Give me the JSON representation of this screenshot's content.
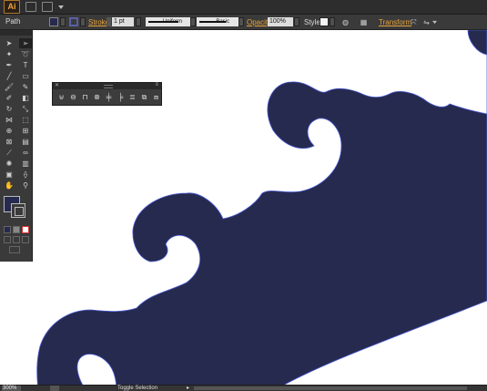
{
  "app": {
    "logo": "Ai"
  },
  "menubar": {
    "icons": [
      "document-icon",
      "workspace-icon"
    ]
  },
  "control": {
    "selection_type": "Path",
    "fill_color": "#262a4e",
    "stroke_color": "#5b5fa8",
    "stroke_label": "Stroke:",
    "stroke_weight": "1 pt",
    "profile_label": "Uniform",
    "brush_label": "Basic",
    "opacity_label": "Opacity:",
    "opacity_value": "100%",
    "style_label": "Style:",
    "transform_label": "Transform"
  },
  "tools": [
    "selection-tool",
    "direct-selection-tool",
    "magic-wand-tool",
    "lasso-tool",
    "pen-tool",
    "type-tool",
    "line-tool",
    "rectangle-tool",
    "paintbrush-tool",
    "pencil-tool",
    "blob-brush-tool",
    "eraser-tool",
    "rotate-tool",
    "scale-tool",
    "width-tool",
    "free-transform-tool",
    "shape-builder-tool",
    "perspective-grid-tool",
    "mesh-tool",
    "gradient-tool",
    "eyedropper-tool",
    "blend-tool",
    "symbol-sprayer-tool",
    "column-graph-tool",
    "artboard-tool",
    "slice-tool",
    "hand-tool",
    "zoom-tool"
  ],
  "panel": {
    "icons": [
      "shape-mode-unite-icon",
      "shape-mode-minus-front-icon",
      "shape-mode-intersect-icon",
      "shape-mode-exclude-icon",
      "align-center-icon",
      "align-left-icon",
      "distribute-icon",
      "pathfinder-divide-icon",
      "pathfinder-trim-icon"
    ]
  },
  "status": {
    "zoom": "300%",
    "text": "Toggle Selection"
  },
  "artwork": {
    "shape_color": "#262a4e",
    "outline_color": "#4a5bd6"
  }
}
